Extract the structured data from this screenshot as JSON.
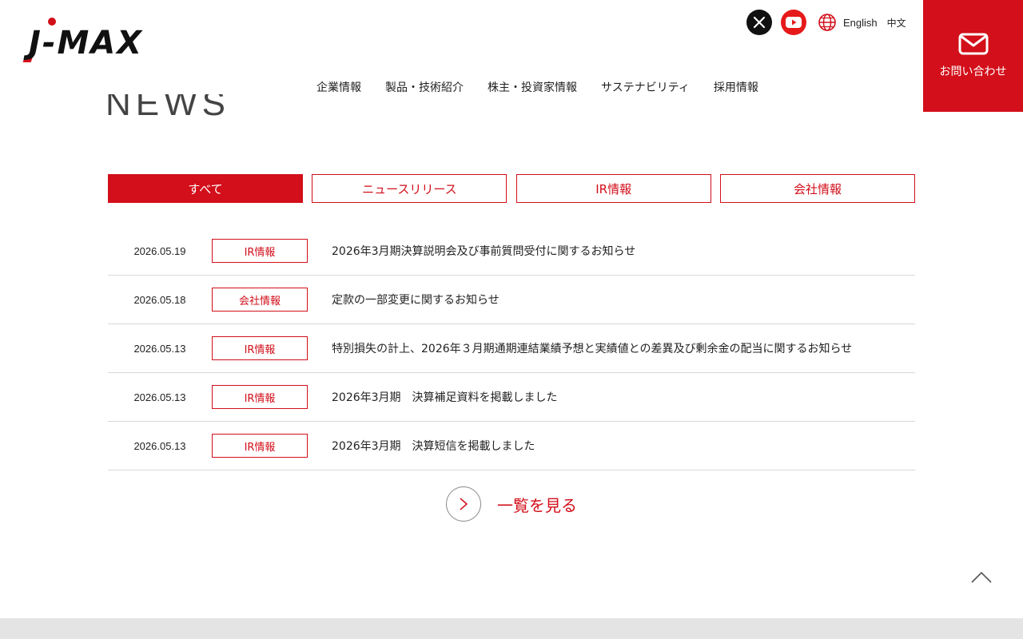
{
  "header": {
    "logo_text": "J-MAX",
    "lang_english": "English",
    "lang_chinese": "中文",
    "contact_label": "お問い合わせ",
    "nav": [
      "企業情報",
      "製品・技術紹介",
      "株主・投資家情報",
      "サステナビリティ",
      "採用情報"
    ]
  },
  "section": {
    "title": "NEWS"
  },
  "tabs": [
    {
      "label": "すべて",
      "active": true
    },
    {
      "label": "ニュースリリース",
      "active": false
    },
    {
      "label": "IR情報",
      "active": false
    },
    {
      "label": "会社情報",
      "active": false
    }
  ],
  "news": [
    {
      "date": "2026.05.19",
      "category": "IR情報",
      "title": "2026年3月期決算説明会及び事前質問受付に関するお知らせ"
    },
    {
      "date": "2026.05.18",
      "category": "会社情報",
      "title": "定款の一部変更に関するお知らせ"
    },
    {
      "date": "2026.05.13",
      "category": "IR情報",
      "title": "特別損失の計上、2026年３月期通期連結業績予想と実績値との差異及び剰余金の配当に関するお知らせ"
    },
    {
      "date": "2026.05.13",
      "category": "IR情報",
      "title": "2026年3月期　決算補足資料を掲載しました"
    },
    {
      "date": "2026.05.13",
      "category": "IR情報",
      "title": "2026年3月期　決算短信を掲載しました"
    }
  ],
  "more_label": "一覧を見る",
  "colors": {
    "brand_red": "#d20f1a",
    "footer_gray": "#e4e4e4"
  }
}
